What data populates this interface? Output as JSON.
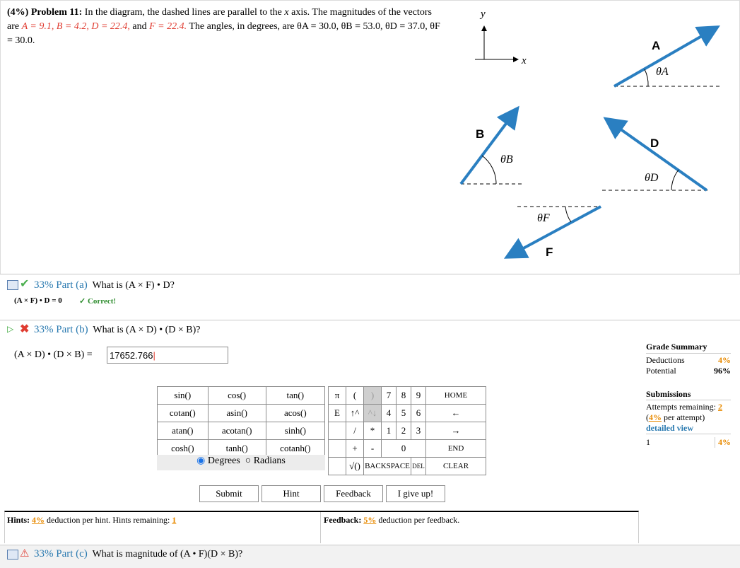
{
  "problem": {
    "header": "(4%) Problem 11:",
    "t1": "In the diagram, the dashed lines are parallel to the",
    "t2": "axis. The magnitudes of the vectors are",
    "t3": "and",
    "t4": "The angles, in degrees, are",
    "A_eq": "A = 9.1,",
    "B_eq": "B = 4.2,",
    "D_eq": "D = 22.4,",
    "F_eq": "F = 22.4.",
    "thA": "θA = 30.0,",
    "thB": "θB = 53.0,",
    "thD": "θD = 37.0,",
    "thF": "θF = 30.0."
  },
  "diagram": {
    "x": "x",
    "y": "y",
    "A": "A",
    "B": "B",
    "D": "D",
    "F": "F",
    "tA": "θA",
    "tB": "θB",
    "tD": "θD",
    "tF": "θF",
    "colors": {
      "vector": "#2a7fc1"
    }
  },
  "part_a": {
    "pct": "33% Part (a)",
    "question": "What is (A × F) • D?",
    "answer": "(A × F) • D = 0",
    "status": "✓ Correct!"
  },
  "part_b": {
    "pct": "33% Part (b)",
    "question": "What is (A × D) • (D × B)?",
    "label": "(A × D) • (D × B) =",
    "value": "17652.766"
  },
  "keyboard": {
    "func_rows": [
      [
        "sin()",
        "cos()",
        "tan()"
      ],
      [
        "cotan()",
        "asin()",
        "acos()"
      ],
      [
        "atan()",
        "acotan()",
        "sinh()"
      ],
      [
        "cosh()",
        "tanh()",
        "cotanh()"
      ]
    ],
    "degrees": "Degrees",
    "radians": "Radians",
    "keys": {
      "pi": "π",
      "lp": "(",
      "rp": ")",
      "n7": "7",
      "n8": "8",
      "n9": "9",
      "home": "HOME",
      "e": "E",
      "up": "↑^",
      "dn": "^↓",
      "n4": "4",
      "n5": "5",
      "n6": "6",
      "back_arrow": "←",
      "div": "/",
      "mul": "*",
      "n1": "1",
      "n2": "2",
      "n3": "3",
      "fwd_arrow": "→",
      "plus": "+",
      "minus": "-",
      "n0": "0",
      "end": "END",
      "sqrt": "√()",
      "backspace": "BACKSPACE",
      "del": "DEL",
      "clear": "CLEAR"
    }
  },
  "actions": {
    "submit": "Submit",
    "hint": "Hint",
    "feedback": "Feedback",
    "give_up": "I give up!"
  },
  "hints": {
    "label": "Hints:",
    "pct": "4%",
    "text": "deduction per hint. Hints remaining:",
    "remaining": "1"
  },
  "feedback": {
    "label": "Feedback:",
    "pct": "5%",
    "text": "deduction per feedback."
  },
  "grade": {
    "title": "Grade Summary",
    "deductions_label": "Deductions",
    "deductions": "4%",
    "potential_label": "Potential",
    "potential": "96%",
    "sub_title": "Submissions",
    "attempts_label": "Attempts remaining:",
    "attempts": "2",
    "per_attempt_pct": "4%",
    "per_attempt": "per attempt)",
    "detailed": "detailed view",
    "row_num": "1",
    "row_pct": "4%"
  },
  "part_c": {
    "pct": "33% Part (c)",
    "question": "What is magnitude of (A • F)(D × B)?"
  }
}
